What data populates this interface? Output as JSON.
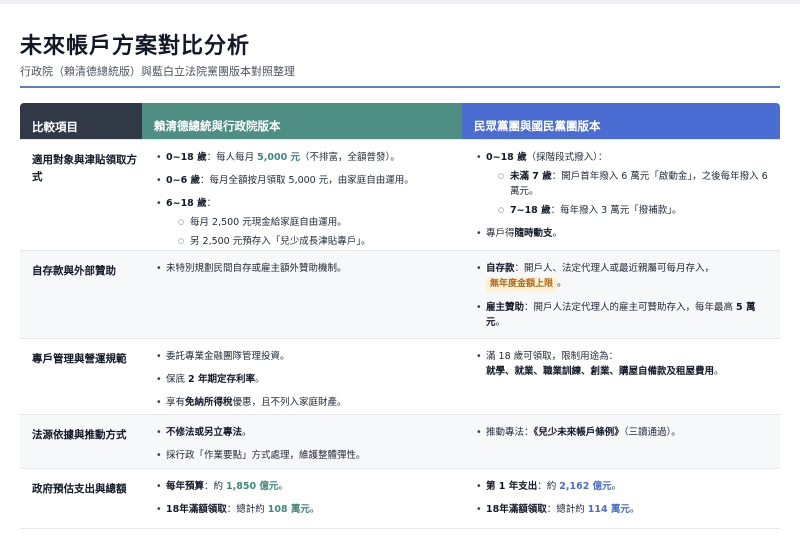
{
  "title": "未來帳戶方案對比分析",
  "subtitle": "行政院（賴清德總統版）與藍白立法院黨團版本對照整理",
  "table": {
    "headers": [
      "比較項目",
      "賴清德總統與行政院版本",
      "民眾黨團與國民黨團版本"
    ],
    "rows": [
      {
        "label": "適用對象與津貼領取方式",
        "left": {
          "i1_a": "0~18 歲",
          "i1_b": "：每人每月 ",
          "i1_c": "5,000 元",
          "i1_d": "（不排富，全額普發）。",
          "i2_a": "0~6 歲",
          "i2_b": "：每月全額按月領取 5,000 元，由家庭自由運用。",
          "i3_a": "6~18 歲",
          "i3_b": "：",
          "i3_s1": "每月 2,500 元現金給家庭自由運用。",
          "i3_s2": "另 2,500 元預存入「兒少成長津貼專戶」。"
        },
        "right": {
          "i1_a": "0~18 歲",
          "i1_b": "（採階段式撥入）：",
          "i1_s1_a": "未滿 7 歲",
          "i1_s1_b": "：開戶首年撥入 6 萬元「啟動金」，之後每年撥入 6 萬元。",
          "i1_s2_a": "7~18 歲",
          "i1_s2_b": "：每年撥入 3 萬元「撥補款」。",
          "i2_a": "專戶得",
          "i2_b": "隨時動支",
          "i2_c": "。"
        }
      },
      {
        "label": "自存款與外部贊助",
        "left": {
          "i1": "未特別規劃民間自存或雇主額外贊助機制。"
        },
        "right": {
          "i1_a": "自存款",
          "i1_b": "：開戶人、法定代理人或最近親屬可每月存入，",
          "i1_tag": "無年度金額上限",
          "i1_c": "。",
          "i2_a": "雇主贊助",
          "i2_b": "：開戶人法定代理人的雇主可贊助存入，每年最高 ",
          "i2_c": "5 萬元",
          "i2_d": "。"
        }
      },
      {
        "label": "專戶管理與營運規範",
        "left": {
          "i1": "委託專業金融團隊管理投資。",
          "i2_a": "保底 ",
          "i2_b": "2 年期定存利率",
          "i2_c": "。",
          "i3_a": "享有",
          "i3_b": "免納所得稅",
          "i3_c": "優惠，且不列入家庭財產。"
        },
        "right": {
          "i1_a": "滿 18 歲可領取，限制用途為：",
          "i1_b": "就學、就業、職業訓練、創業、購屋自備款及租屋費用",
          "i1_c": "。"
        }
      },
      {
        "label": "法源依據與推動方式",
        "left": {
          "i1_a": "不修法或另立專法",
          "i1_b": "。",
          "i2": "採行政「作業要點」方式處理，維護整體彈性。"
        },
        "right": {
          "i1_a": "推動專法：",
          "i1_b": "《兒少未來帳戶條例》",
          "i1_c": "（三讀通過）。"
        }
      },
      {
        "label": "政府預估支出與總額",
        "left": {
          "i1_a": "每年預算",
          "i1_b": "：約 ",
          "i1_c": "1,850 億元",
          "i1_d": "。",
          "i2_a": "18年滿額領取",
          "i2_b": "：總計約 ",
          "i2_c": "108 萬元",
          "i2_d": "。"
        },
        "right": {
          "i1_a": "第 1 年支出",
          "i1_b": "：約 ",
          "i1_c": "2,162 億元",
          "i1_d": "。",
          "i2_a": "18年滿額領取",
          "i2_b": "：總計約 ",
          "i2_c": "114 萬元",
          "i2_d": "。"
        }
      }
    ]
  },
  "colors": {
    "header_dark": "#313846",
    "header_green": "#4e8e83",
    "header_blue": "#4a6cd3",
    "accent_green": "#3d8a7c",
    "accent_blue": "#4a6cd3",
    "rule_blue": "#5b7fc7",
    "tag_bg": "#fdf1d6",
    "tag_text": "#b06a1b"
  }
}
